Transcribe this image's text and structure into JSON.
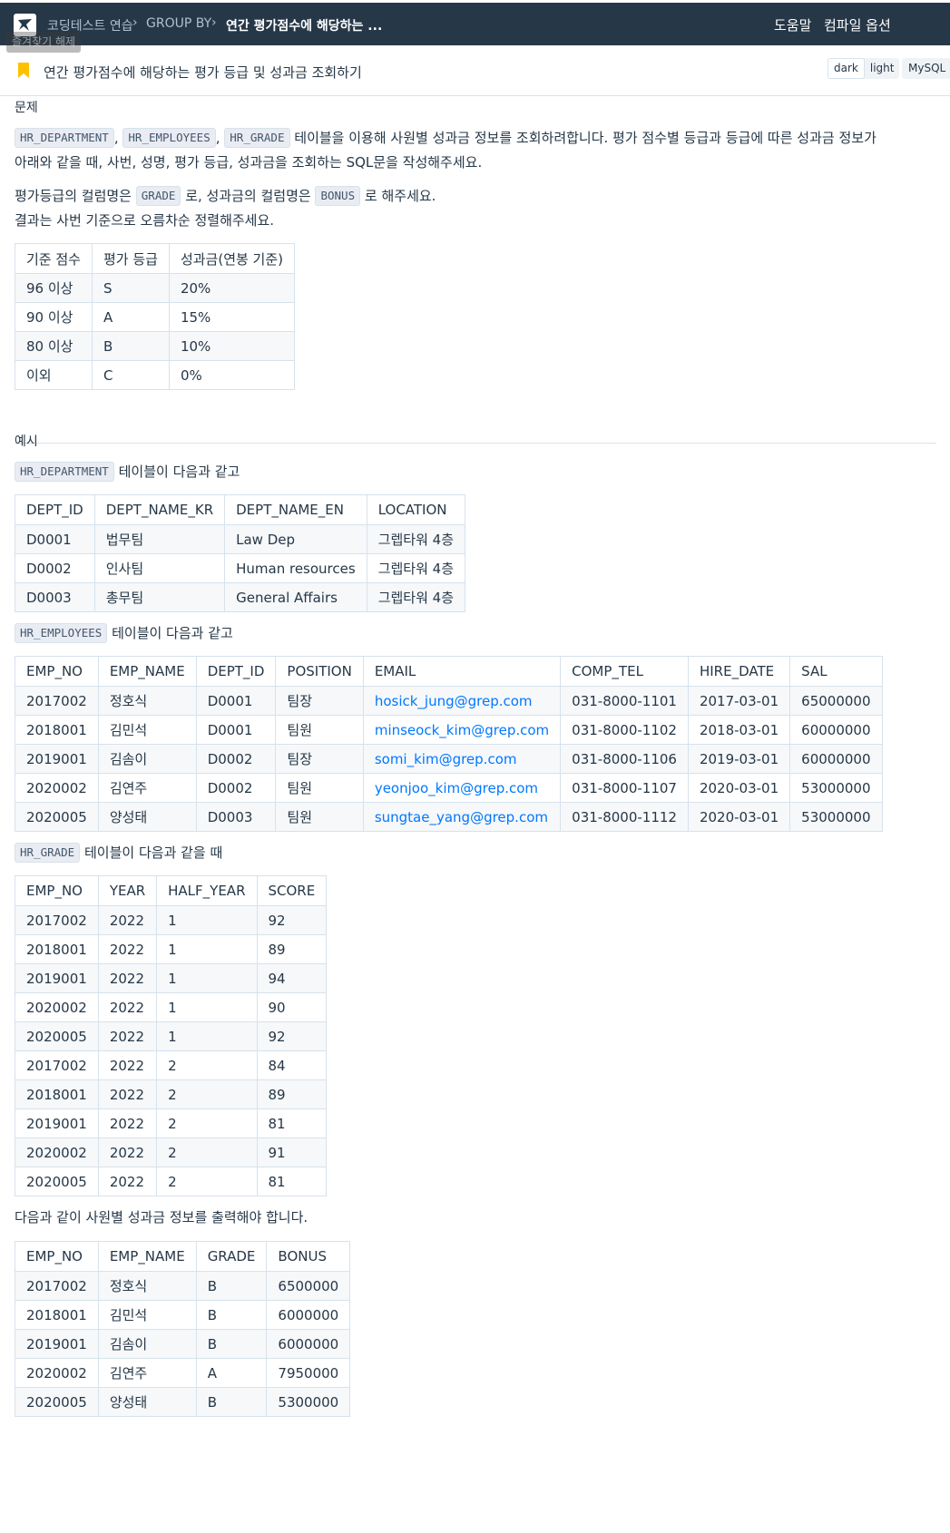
{
  "nav": {
    "breadcrumbs": [
      "코딩테스트 연습",
      "GROUP BY",
      "연간 평가점수에 해당하는 ..."
    ],
    "help": "도움말",
    "compile_options": "컴파일 옵션"
  },
  "tooltip": "즐겨찾기 해제",
  "title_bar": {
    "title": "연간 평가점수에 해당하는 평가 등급 및 성과금 조회하기",
    "theme_dark": "dark",
    "theme_light": "light",
    "language": "MySQL"
  },
  "problem": {
    "label": "문제",
    "tables": [
      "HR_DEPARTMENT",
      "HR_EMPLOYEES",
      "HR_GRADE"
    ],
    "sep": ",",
    "line1_text": "테이블을 이용해 사원별 성과금 정보를 조회하려합니다. 평가 점수별 등급과 등급에 따른 성과금 정보가",
    "line2_text": "아래와 같을 때, 사번, 성명, 평가 등급, 성과금을 조회하는 SQL문을 작성해주세요.",
    "line3_pre": "평가등급의 컬럼명은",
    "line3_code1": "GRADE",
    "line3_mid": "로, 성과금의 컬럼명은",
    "line3_code2": "BONUS",
    "line3_post": "로 해주세요.",
    "line4_text": "결과는 사번 기준으로 오름차순 정렬해주세요.",
    "grade_table": {
      "headers": [
        "기준 점수",
        "평가 등급",
        "성과금(연봉 기준)"
      ],
      "rows": [
        [
          "96 이상",
          "S",
          "20%"
        ],
        [
          "90 이상",
          "A",
          "15%"
        ],
        [
          "80 이상",
          "B",
          "10%"
        ],
        [
          "이외",
          "C",
          "0%"
        ]
      ]
    }
  },
  "example": {
    "label": "예시",
    "dept_caption_code": "HR_DEPARTMENT",
    "dept_caption_text": "테이블이 다음과 같고",
    "dept_table": {
      "headers": [
        "DEPT_ID",
        "DEPT_NAME_KR",
        "DEPT_NAME_EN",
        "LOCATION"
      ],
      "rows": [
        [
          "D0001",
          "법무팀",
          "Law Dep",
          "그렙타워 4층"
        ],
        [
          "D0002",
          "인사팀",
          "Human resources",
          "그렙타워 4층"
        ],
        [
          "D0003",
          "총무팀",
          "General Affairs",
          "그렙타워 4층"
        ]
      ]
    },
    "emp_caption_code": "HR_EMPLOYEES",
    "emp_caption_text": "테이블이 다음과 같고",
    "emp_table": {
      "headers": [
        "EMP_NO",
        "EMP_NAME",
        "DEPT_ID",
        "POSITION",
        "EMAIL",
        "COMP_TEL",
        "HIRE_DATE",
        "SAL"
      ],
      "rows": [
        [
          "2017002",
          "정호식",
          "D0001",
          "팀장",
          "hosick_jung@grep.com",
          "031-8000-1101",
          "2017-03-01",
          "65000000"
        ],
        [
          "2018001",
          "김민석",
          "D0001",
          "팀원",
          "minseock_kim@grep.com",
          "031-8000-1102",
          "2018-03-01",
          "60000000"
        ],
        [
          "2019001",
          "김솜이",
          "D0002",
          "팀장",
          "somi_kim@grep.com",
          "031-8000-1106",
          "2019-03-01",
          "60000000"
        ],
        [
          "2020002",
          "김연주",
          "D0002",
          "팀원",
          "yeonjoo_kim@grep.com",
          "031-8000-1107",
          "2020-03-01",
          "53000000"
        ],
        [
          "2020005",
          "양성태",
          "D0003",
          "팀원",
          "sungtae_yang@grep.com",
          "031-8000-1112",
          "2020-03-01",
          "53000000"
        ]
      ]
    },
    "grade_caption_code": "HR_GRADE",
    "grade_caption_text": "테이블이 다음과 같을 때",
    "grade_table": {
      "headers": [
        "EMP_NO",
        "YEAR",
        "HALF_YEAR",
        "SCORE"
      ],
      "rows": [
        [
          "2017002",
          "2022",
          "1",
          "92"
        ],
        [
          "2018001",
          "2022",
          "1",
          "89"
        ],
        [
          "2019001",
          "2022",
          "1",
          "94"
        ],
        [
          "2020002",
          "2022",
          "1",
          "90"
        ],
        [
          "2020005",
          "2022",
          "1",
          "92"
        ],
        [
          "2017002",
          "2022",
          "2",
          "84"
        ],
        [
          "2018001",
          "2022",
          "2",
          "89"
        ],
        [
          "2019001",
          "2022",
          "2",
          "81"
        ],
        [
          "2020002",
          "2022",
          "2",
          "91"
        ],
        [
          "2020005",
          "2022",
          "2",
          "81"
        ]
      ]
    },
    "result_caption": "다음과 같이 사원별 성과금 정보를 출력해야 합니다.",
    "result_table": {
      "headers": [
        "EMP_NO",
        "EMP_NAME",
        "GRADE",
        "BONUS"
      ],
      "rows": [
        [
          "2017002",
          "정호식",
          "B",
          "6500000"
        ],
        [
          "2018001",
          "김민석",
          "B",
          "6000000"
        ],
        [
          "2019001",
          "김솜이",
          "B",
          "6000000"
        ],
        [
          "2020002",
          "김연주",
          "A",
          "7950000"
        ],
        [
          "2020005",
          "양성태",
          "B",
          "5300000"
        ]
      ]
    }
  },
  "colors": {
    "nav_bg": "#263747",
    "text": "#263747",
    "link": "#0078ff",
    "bookmark": "#ffc000",
    "border": "#d7e2eb"
  }
}
